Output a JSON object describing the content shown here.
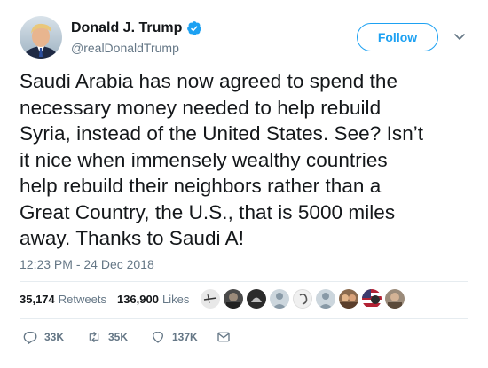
{
  "author": {
    "display_name": "Donald J. Trump",
    "handle": "@realDonaldTrump",
    "verified": true
  },
  "header": {
    "follow_label": "Follow",
    "caret_icon": "chevron-down-icon"
  },
  "tweet": {
    "text_lines": [
      "Saudi Arabia has now agreed to spend the",
      "necessary money needed to help rebuild",
      "Syria, instead of the United States. See? Isn’t",
      "it nice when immensely wealthy countries",
      "help rebuild their neighbors rather than a",
      "Great Country, the U.S., that is 5000 miles",
      "away. Thanks to Saudi A!"
    ],
    "timestamp": "12:23 PM - 24 Dec 2018"
  },
  "stats": {
    "retweets_count": "35,174",
    "retweets_label": "Retweets",
    "likes_count": "136,900",
    "likes_label": "Likes"
  },
  "facepile": [
    {
      "name": "liker-avatar-1",
      "color": "#d9d9d9"
    },
    {
      "name": "liker-avatar-2",
      "color": "#4a4a4a"
    },
    {
      "name": "liker-avatar-3",
      "color": "#2b2b2b"
    },
    {
      "name": "liker-avatar-4",
      "color": "#aab8c2"
    },
    {
      "name": "liker-avatar-5",
      "color": "#e1e8ed"
    },
    {
      "name": "liker-avatar-6",
      "color": "#aab8c2"
    },
    {
      "name": "liker-avatar-7",
      "color": "#8a6a4e"
    },
    {
      "name": "liker-avatar-8",
      "color": "#b03a2e"
    },
    {
      "name": "liker-avatar-9",
      "color": "#9b8b7a"
    }
  ],
  "actions": {
    "reply_count": "33K",
    "retweet_count": "35K",
    "like_count": "137K",
    "reply_icon": "reply-icon",
    "retweet_icon": "retweet-icon",
    "like_icon": "heart-icon",
    "dm_icon": "envelope-icon"
  },
  "colors": {
    "accent": "#1da1f2",
    "secondary_text": "#657786",
    "primary_text": "#14171a",
    "divider": "#e6ecf0"
  }
}
